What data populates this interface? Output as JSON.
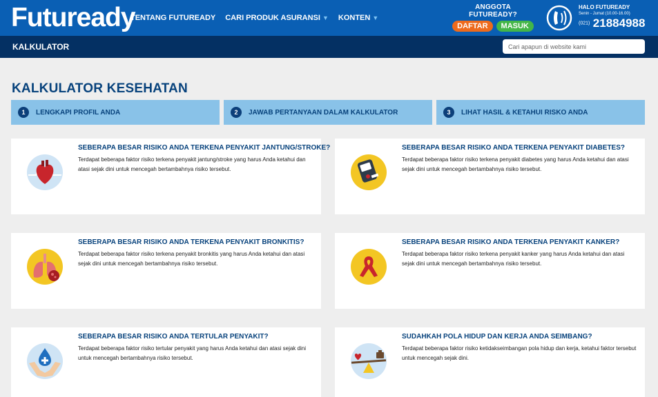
{
  "header": {
    "logo": "Futuready",
    "nav": [
      {
        "label": "TENTANG FUTUREADY",
        "dropdown": false
      },
      {
        "label": "CARI PRODUK ASURANSI",
        "dropdown": true
      },
      {
        "label": "KONTEN",
        "dropdown": true
      }
    ],
    "member_title": "ANGGOTA FUTUREADY?",
    "daftar_label": "DAFTAR",
    "masuk_label": "MASUK",
    "contact": {
      "title": "HALO FUTUREADY",
      "hours": "Senin - Jumat (10.00-16.00)",
      "prefix": "(021)",
      "number": "21884988"
    }
  },
  "subbar": {
    "title": "KALKULATOR",
    "search_placeholder": "Cari apapun di website kami"
  },
  "page": {
    "title": "KALKULATOR KESEHATAN",
    "steps": [
      {
        "num": "1",
        "label": "LENGKAPI PROFIL ANDA"
      },
      {
        "num": "2",
        "label": "JAWAB PERTANYAAN DALAM KALKULATOR"
      },
      {
        "num": "3",
        "label": "LIHAT HASIL & KETAHUI RISKO ANDA"
      }
    ],
    "cards": [
      {
        "icon": "heart-icon",
        "title": "SEBERAPA BESAR RISIKO ANDA TERKENA PENYAKIT JANTUNG/STROKE?",
        "desc": "Terdapat beberapa faktor risiko terkena penyakit jantung/stroke yang harus Anda ketahui dan atasi sejak dini untuk mencegah bertambahnya risiko tersebut."
      },
      {
        "icon": "glucometer-icon",
        "title": "SEBERAPA BESAR RISIKO ANDA TERKENA PENYAKIT DIABETES?",
        "desc": "Terdapat beberapa faktor risiko terkena penyakit diabetes yang harus Anda ketahui dan atasi sejak dini untuk mencegah bertambahnya risiko tersebut."
      },
      {
        "icon": "lungs-icon",
        "title": "SEBERAPA BESAR RISIKO ANDA TERKENA PENYAKIT BRONKITIS?",
        "desc": "Terdapat beberapa faktor risiko terkena penyakit bronkitis yang harus Anda ketahui dan atasi sejak dini untuk mencegah bertambahnya risiko tersebut."
      },
      {
        "icon": "ribbon-icon",
        "title": "SEBERAPA BESAR RISIKO ANDA TERKENA PENYAKIT KANKER?",
        "desc": "Terdapat beberapa faktor risiko terkena penyakit kanker yang harus Anda ketahui dan atasi sejak dini untuk mencegah bertambahnya risiko tersebut."
      },
      {
        "icon": "hands-drop-icon",
        "title": "SEBERAPA BESAR RISIKO ANDA TERTULAR PENYAKIT?",
        "desc": "Terdapat beberapa faktor risiko tertular penyakit yang harus Anda ketahui dan atasi sejak dini untuk mencegah bertambahnya risiko tersebut."
      },
      {
        "icon": "balance-icon",
        "title": "SUDAHKAH POLA HIDUP DAN KERJA ANDA SEIMBANG?",
        "desc": "Terdapat beberapa faktor risiko ketidakseimbangan pola hidup dan kerja, ketahui faktor tersebut untuk mencegah sejak dini."
      }
    ]
  },
  "colors": {
    "header_blue": "#0a5fb4",
    "subbar_navy": "#043063",
    "title_blue": "#07427c",
    "step_bg": "#89c2e8",
    "daftar_orange": "#ee6a1c",
    "masuk_green": "#43b648"
  }
}
